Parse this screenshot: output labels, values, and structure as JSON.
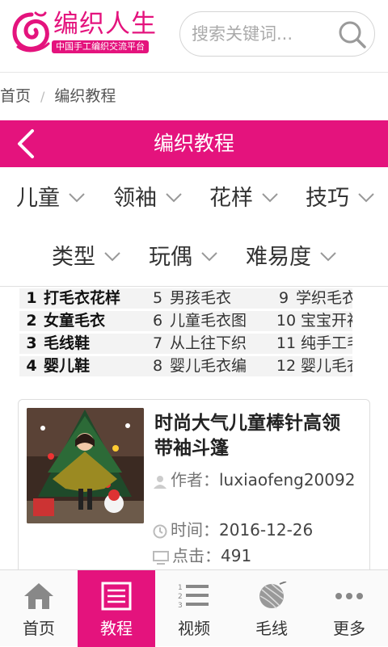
{
  "brand": {
    "title": "编织人生",
    "subtitle": "中国手工编织交流平台",
    "accent": "#e4137d"
  },
  "search": {
    "placeholder": "搜索关键词..."
  },
  "breadcrumb": {
    "home": "首页",
    "separator": "/",
    "current": "编织教程"
  },
  "titlebar": {
    "title": "编织教程"
  },
  "categories": {
    "row1": [
      "儿童",
      "领袖",
      "花样",
      "技巧"
    ],
    "row2": [
      "类型",
      "玩偶",
      "难易度"
    ]
  },
  "hot_list": [
    [
      {
        "n": "1",
        "t": "打毛衣花样"
      },
      {
        "n": "5",
        "t": "男孩毛衣"
      },
      {
        "n": "9",
        "t": "学织毛衣"
      }
    ],
    [
      {
        "n": "2",
        "t": "女童毛衣"
      },
      {
        "n": "6",
        "t": "儿童毛衣图"
      },
      {
        "n": "10",
        "t": "宝宝开衫"
      }
    ],
    [
      {
        "n": "3",
        "t": "毛线鞋"
      },
      {
        "n": "7",
        "t": "从上往下织"
      },
      {
        "n": "11",
        "t": "纯手工毛"
      }
    ],
    [
      {
        "n": "4",
        "t": "婴儿鞋"
      },
      {
        "n": "8",
        "t": "婴儿毛衣编"
      },
      {
        "n": "12",
        "t": "婴儿毛衣"
      }
    ]
  ],
  "article": {
    "title": "时尚大气儿童棒针高领带袖斗篷",
    "author_label": "作者：",
    "author": "luxiaofeng20092",
    "time_label": "时间：",
    "time": "2016-12-26",
    "views_label": "点击：",
    "views": "491"
  },
  "tabs": [
    {
      "label": "首页",
      "icon": "home-icon"
    },
    {
      "label": "教程",
      "icon": "document-icon"
    },
    {
      "label": "视频",
      "icon": "list-icon"
    },
    {
      "label": "毛线",
      "icon": "yarn-ball-icon"
    },
    {
      "label": "更多",
      "icon": "more-icon"
    }
  ]
}
